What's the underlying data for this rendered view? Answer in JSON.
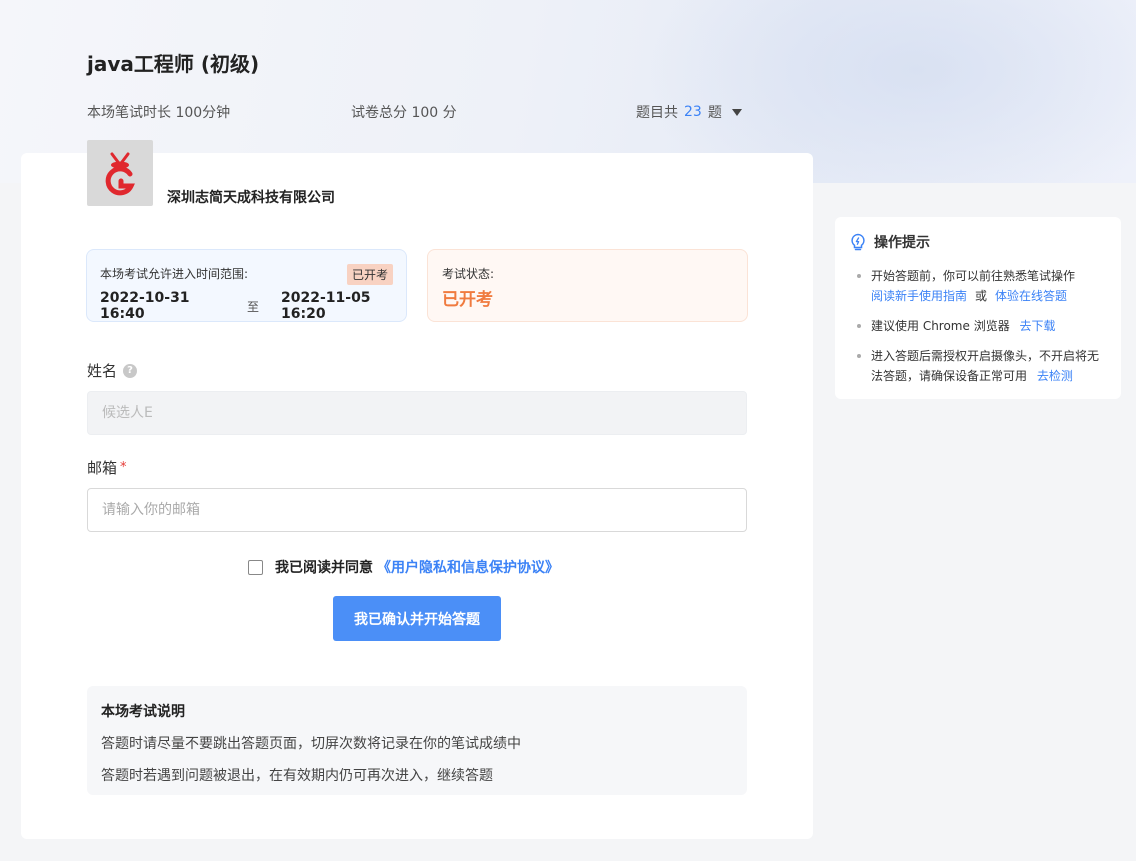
{
  "exam": {
    "title": "java工程师 (初级)",
    "duration": "本场笔试时长 100分钟",
    "total_score": "试卷总分 100 分",
    "question_count_prefix": "题目共",
    "question_count": "23",
    "question_count_suffix": "题"
  },
  "company": {
    "name": "深圳志简天成科技有限公司"
  },
  "time_range": {
    "label": "本场考试允许进入时间范围:",
    "badge": "已开考",
    "start": "2022-10-31 16:40",
    "to": "至",
    "end": "2022-11-05 16:20"
  },
  "status": {
    "label": "考试状态:",
    "value": "已开考",
    "color": "#f07b3f"
  },
  "form": {
    "name_label": "姓名",
    "name_help": "?",
    "name_value": "候选人E",
    "email_label": "邮箱",
    "email_required": "*",
    "email_placeholder": "请输入你的邮箱",
    "agree_text": "我已阅读并同意",
    "agree_link": "《用户隐私和信息保护协议》",
    "start_button": "我已确认并开始答题"
  },
  "notes": {
    "title": "本场考试说明",
    "lines": [
      "答题时请尽量不要跳出答题页面，切屏次数将记录在你的笔试成绩中",
      "答题时若遇到问题被退出，在有效期内仍可再次进入，继续答题"
    ]
  },
  "tips": {
    "title": "操作提示",
    "tip1_text": "开始答题前，你可以前往熟悉笔试操作",
    "tip1_link1": "阅读新手使用指南",
    "tip1_or": "或",
    "tip1_link2": "体验在线答题",
    "tip2_text": "建议使用 Chrome 浏览器",
    "tip2_link": "去下载",
    "tip3_text": "进入答题后需授权开启摄像头，不开启将无法答题，请确保设备正常可用",
    "tip3_link": "去检测"
  },
  "colors": {
    "accent": "#3b82f6",
    "button": "#4b8ff7",
    "logo_red": "#e0282e"
  }
}
